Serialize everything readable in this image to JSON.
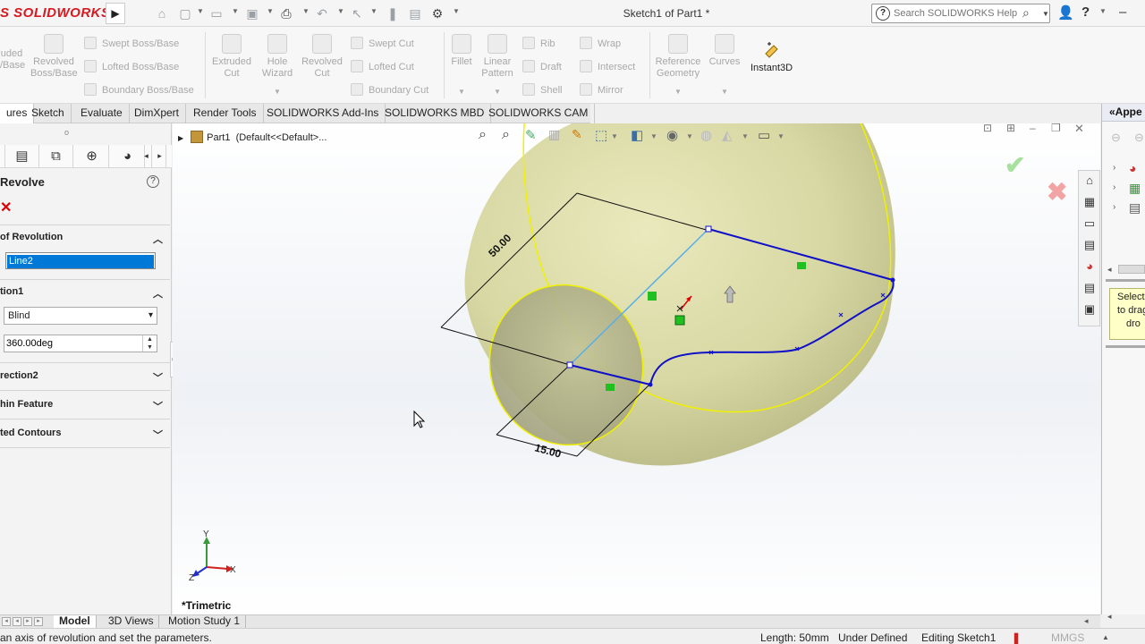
{
  "app": {
    "logo_text": "S SOLIDWORKS",
    "document_title": "Sketch1 of Part1 *",
    "search_placeholder": "Search SOLIDWORKS Help"
  },
  "ribbon": {
    "large_buttons": [
      {
        "label1": "uded",
        "label2": "/Base"
      },
      {
        "label1": "Revolved",
        "label2": "Boss/Base"
      },
      {
        "label1": "Extruded",
        "label2": "Cut"
      },
      {
        "label1": "Hole",
        "label2": "Wizard"
      },
      {
        "label1": "Revolved",
        "label2": "Cut"
      },
      {
        "label1": "Fillet",
        "label2": ""
      },
      {
        "label1": "Linear",
        "label2": "Pattern"
      },
      {
        "label1": "Reference",
        "label2": "Geometry"
      },
      {
        "label1": "Curves",
        "label2": ""
      }
    ],
    "small_buttons": [
      "Swept Boss/Base",
      "Lofted Boss/Base",
      "Boundary Boss/Base",
      "Swept Cut",
      "Lofted Cut",
      "Boundary Cut",
      "Rib",
      "Draft",
      "Shell",
      "Wrap",
      "Intersect",
      "Mirror"
    ],
    "instant3d": "Instant3D"
  },
  "tabs": [
    "ures",
    "Sketch",
    "Evaluate",
    "DimXpert",
    "Render Tools",
    "SOLIDWORKS Add-Ins",
    "SOLIDWORKS MBD",
    "SOLIDWORKS CAM"
  ],
  "property_manager": {
    "title": "Revolve",
    "cancel_symbol": "✕",
    "help_symbol": "?",
    "sections": {
      "axis": "of Revolution",
      "direction1": "tion1",
      "direction2": "rection2",
      "thin": "hin Feature",
      "contours": "ted Contours"
    },
    "axis_value": "Line2",
    "end_condition": "Blind",
    "angle_value": "360.00deg"
  },
  "viewport": {
    "tree_part": "Part1",
    "tree_config": "(Default<<Default>...",
    "dim_long": "50.00",
    "dim_short": "15.00",
    "view_name": "*Trimetric",
    "axis_labels": {
      "x": "X",
      "y": "Y",
      "z": "Z"
    },
    "ok_symbol": "✔",
    "cancel_symbol": "✖"
  },
  "task_pane": {
    "title": "«Appe",
    "tooltip_lines": [
      "Select",
      "to drag",
      "dro"
    ]
  },
  "bottom_tabs": [
    "Model",
    "3D Views",
    "Motion Study 1"
  ],
  "status": {
    "message": "an axis of revolution and set the parameters.",
    "length": "Length: 50mm",
    "definition": "Under Defined",
    "editing": "Editing Sketch1",
    "units": "MMGS"
  },
  "colors": {
    "brand_red": "#d71920",
    "sketch_blue": "#1010c8",
    "model_yellow": "#e2e2a8",
    "selection_blue": "#0078d7"
  }
}
